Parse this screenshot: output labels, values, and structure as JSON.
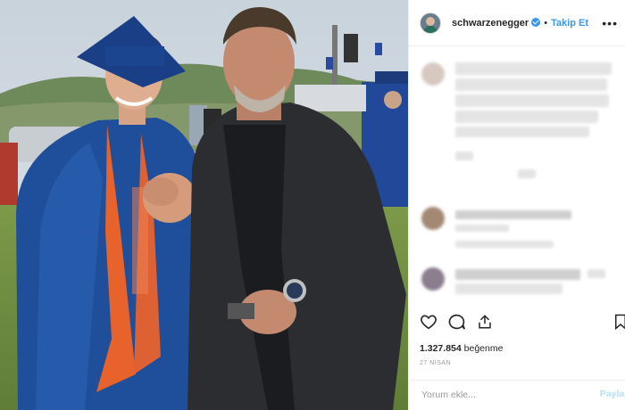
{
  "post": {
    "username": "schwarzenegger",
    "separator": "•",
    "follow_label": "Takip Et",
    "more_icon": "•••",
    "likes_count": "1.327.854",
    "likes_label": "beğenme",
    "date": "27 NİSAN",
    "comment_placeholder": "Yorum ekle...",
    "share_label": "Paylaş"
  },
  "colors": {
    "accent": "#3897f0",
    "gown": "#1f4f9a",
    "stole": "#e8622c",
    "jacket": "#2b2d31"
  },
  "icons": [
    "heart-icon",
    "comment-icon",
    "share-icon",
    "bookmark-icon",
    "verified-badge-icon"
  ]
}
